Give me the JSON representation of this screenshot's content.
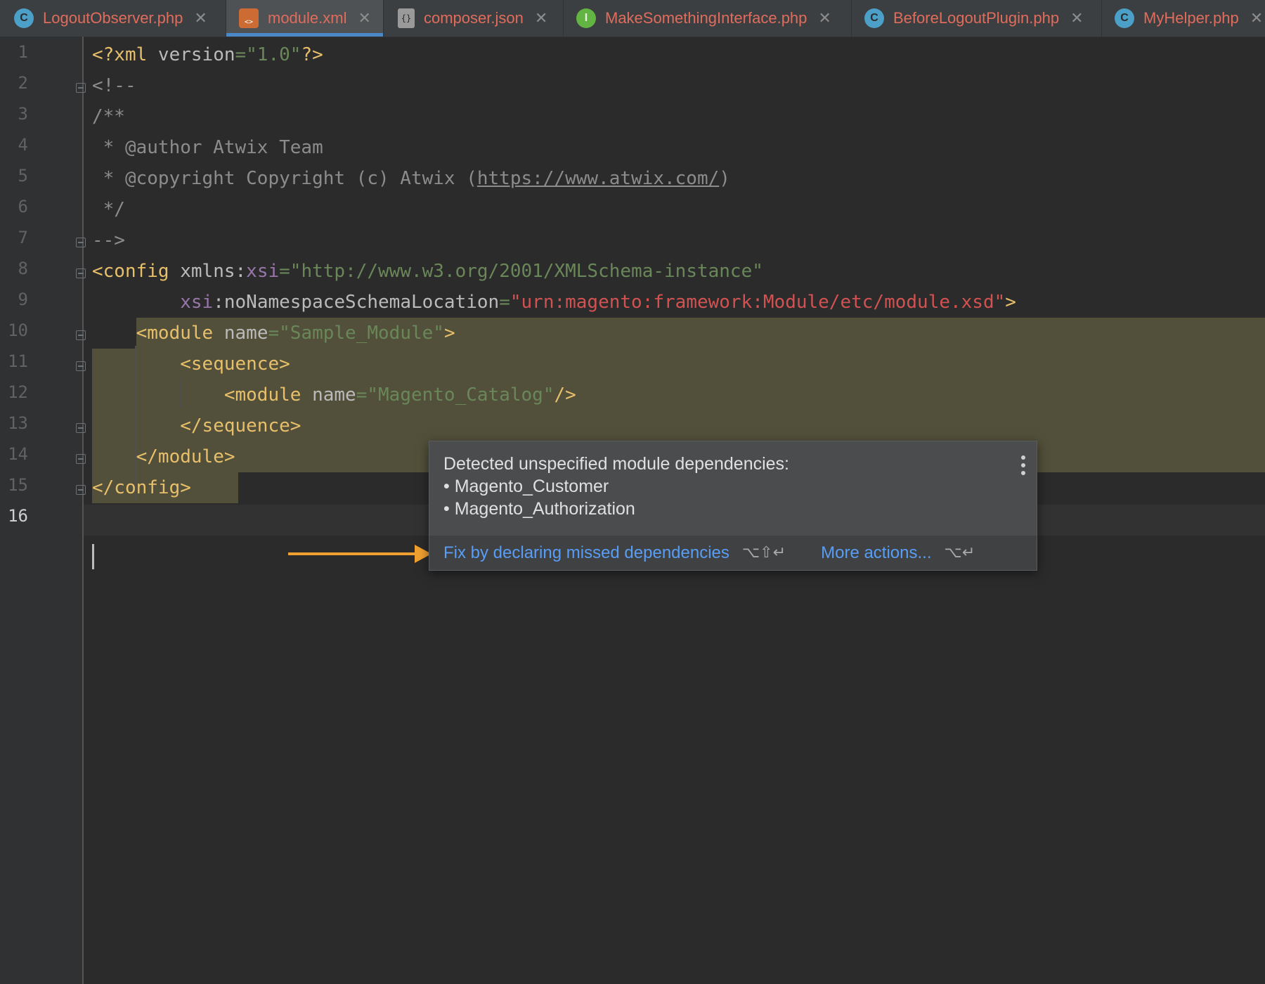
{
  "tabs": [
    {
      "label": "LogoutObserver.php",
      "icon": "class-icon",
      "icon_glyph": "C",
      "active": false
    },
    {
      "label": "module.xml",
      "icon": "xml-file-icon",
      "icon_glyph": "<>",
      "active": true
    },
    {
      "label": "composer.json",
      "icon": "json-file-icon",
      "icon_glyph": "{}",
      "active": false
    },
    {
      "label": "MakeSomethingInterface.php",
      "icon": "interface-icon",
      "icon_glyph": "I",
      "active": false
    },
    {
      "label": "BeforeLogoutPlugin.php",
      "icon": "class-icon",
      "icon_glyph": "C",
      "active": false
    },
    {
      "label": "MyHelper.php",
      "icon": "class-icon",
      "icon_glyph": "C",
      "active": false
    }
  ],
  "close_glyph": "✕",
  "line_numbers": [
    "1",
    "2",
    "3",
    "4",
    "5",
    "6",
    "7",
    "8",
    "9",
    "10",
    "11",
    "12",
    "13",
    "14",
    "15",
    "16"
  ],
  "current_line": "16",
  "code": {
    "l1": {
      "a": "<?xml ",
      "b": "version",
      "c": "=",
      "d": "\"1.0\"",
      "e": "?>"
    },
    "l2": "<!--",
    "l3": "/**",
    "l4": " * @author Atwix Team",
    "l5a": " * @copyright Copyright (c) Atwix (",
    "l5b": "https://www.atwix.com/",
    "l5c": ")",
    "l6": " */",
    "l7": "-->",
    "l8": {
      "a": "<config ",
      "b": "xmlns",
      "c": ":",
      "d": "xsi",
      "e": "=",
      "f": "\"http://www.w3.org/2001/XMLSchema-instance\""
    },
    "l9": {
      "a": "        ",
      "b": "xsi",
      "c": ":",
      "d": "noNamespaceSchemaLocation",
      "e": "=",
      "f": "\"",
      "g": "urn:magento:framework:Module/etc/module.xsd",
      "h": "\"",
      "i": ">"
    },
    "l10": {
      "a": "    ",
      "b": "<module ",
      "c": "name",
      "d": "=",
      "e": "\"Sample_Module\"",
      "f": ">"
    },
    "l11": {
      "a": "        ",
      "b": "<sequence>"
    },
    "l12": {
      "a": "            ",
      "b": "<module ",
      "c": "name",
      "d": "=",
      "e": "\"Magento_Catalog\"",
      "f": "/>"
    },
    "l13": {
      "a": "        ",
      "b": "</sequence>"
    },
    "l14": {
      "a": "    ",
      "b": "</module>"
    },
    "l15": "</config>"
  },
  "popup": {
    "title": "Detected unspecified module dependencies:",
    "items": [
      "• Magento_Customer",
      "• Magento_Authorization"
    ],
    "primary_action": "Fix by declaring missed dependencies",
    "primary_shortcut": "⌥⇧↵",
    "secondary_action": "More actions...",
    "secondary_shortcut": "⌥↵"
  },
  "colors": {
    "accent": "#4a88c7",
    "arrow": "#f0a030",
    "link": "#589df6"
  }
}
